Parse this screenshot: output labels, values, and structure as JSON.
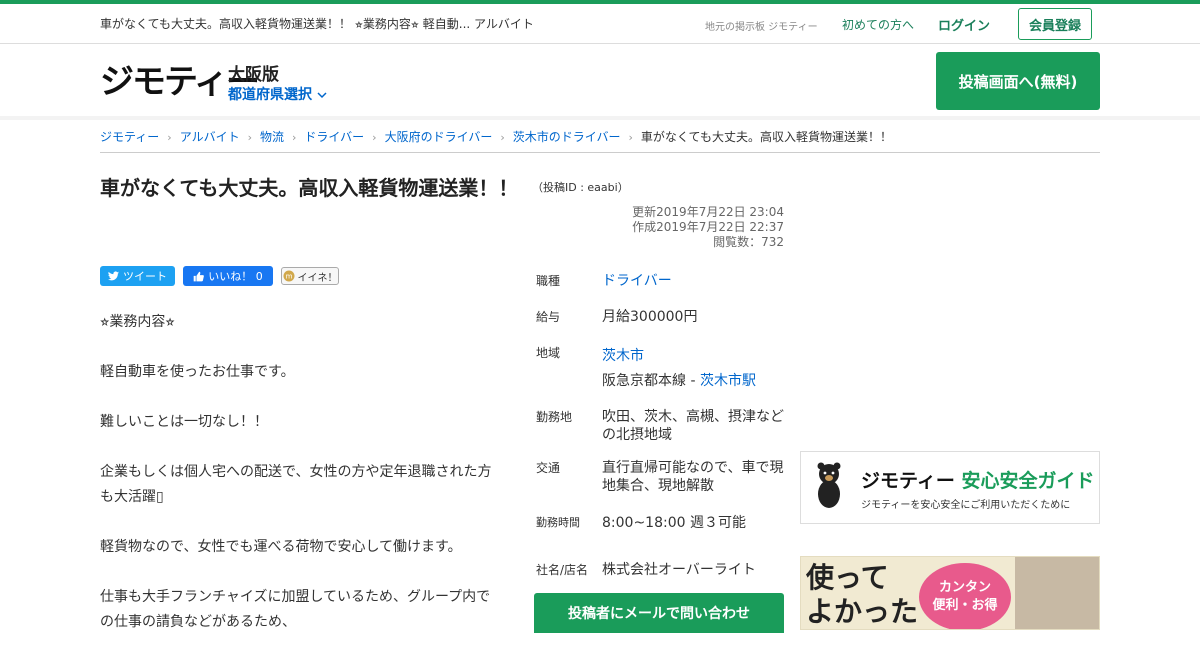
{
  "utility": {
    "head_text": "車がなくても大丈夫。高収入軽貨物運送業！！ ⭐︎業務内容⭐︎ 軽自動... アルバイト",
    "tagline": "地元の掲示板 ジモティー",
    "first_time": "初めての方へ",
    "login": "ログイン",
    "register": "会員登録"
  },
  "header": {
    "logo": "ジモティー",
    "region": "大阪版",
    "pref_select": "都道府県選択",
    "post_button": "投稿画面へ(無料)"
  },
  "breadcrumb": [
    {
      "label": "ジモティー"
    },
    {
      "label": "アルバイト"
    },
    {
      "label": "物流"
    },
    {
      "label": "ドライバー"
    },
    {
      "label": "大阪府のドライバー"
    },
    {
      "label": "茨木市のドライバー"
    },
    {
      "label": "車がなくても大丈夫。高収入軽貨物運送業！！"
    }
  ],
  "post": {
    "title": "車がなくても大丈夫。高収入軽貨物運送業！！",
    "post_id": "（投稿ID : eaabi）",
    "updated": "更新2019年7月22日 23:04",
    "created": "作成2019年7月22日 22:37",
    "views": "閲覧数：732"
  },
  "social": {
    "tweet": "ツイート",
    "like": "いいね！ 0",
    "iine": "イイネ！"
  },
  "description": [
    "⭐︎業務内容⭐︎",
    "軽自動車を使ったお仕事です。",
    "難しいことは一切なし！！",
    "企業もしくは個人宅への配送で、女性の方や定年退職された方も大活躍▯",
    "軽貨物なので、女性でも運べる荷物で安心して働けます。",
    "仕事も大手フランチャイズに加盟しているため、グループ内での仕事の請負などがあるため、"
  ],
  "details": {
    "job_type_label": "職種",
    "job_type": "ドライバー",
    "salary_label": "給与",
    "salary": "月給300000円",
    "area_label": "地域",
    "area_city": "茨木市",
    "area_line": "阪急京都本線 - ",
    "area_station": "茨木市駅",
    "workplace_label": "勤務地",
    "workplace": "吹田、茨木、高槻、摂津などの北摂地域",
    "transport_label": "交通",
    "transport": "直行直帰可能なので、車で現地集合、現地解散",
    "hours_label": "勤務時間",
    "hours": "8:00~18:00 週３可能",
    "company_label": "社名/店名",
    "company": "株式会社オーバーライト",
    "contact_button": "投稿者にメールで問い合わせ"
  },
  "guide_banner": {
    "brand": "ジモティー",
    "title": "安心安全ガイド",
    "subtitle": "ジモティーを安心安全にご利用いただくために"
  },
  "promo_banner": {
    "line1": "使って",
    "line2": "よかった",
    "badge1": "カンタン",
    "badge2": "便利・お得"
  },
  "colors": {
    "brand_green": "#1a9c5a",
    "link_blue": "#0066cc"
  }
}
